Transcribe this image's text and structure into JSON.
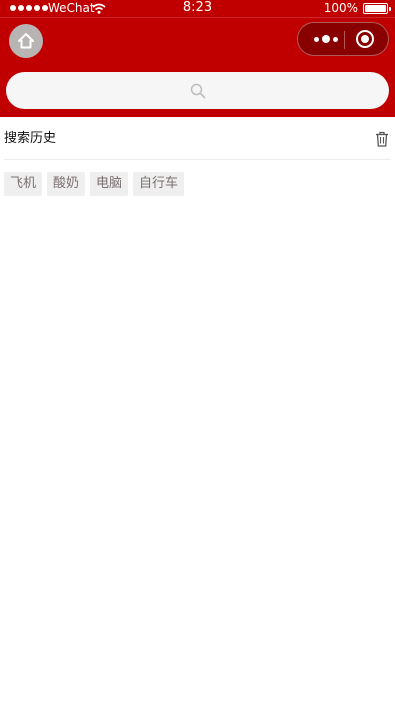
{
  "status_bar": {
    "carrier": "WeChat",
    "time": "8:23",
    "battery": "100%"
  },
  "nav": {
    "home_icon": "home-icon",
    "more_icon": "more-dots-icon",
    "close_icon": "mini-program-close-icon",
    "theme_color": "#c00000"
  },
  "search": {
    "placeholder": "",
    "value": "",
    "icon": "search-icon"
  },
  "history": {
    "title": "搜索历史",
    "clear_icon": "trash-icon",
    "items": [
      "飞机",
      "酸奶",
      "电脑",
      "自行车"
    ]
  }
}
